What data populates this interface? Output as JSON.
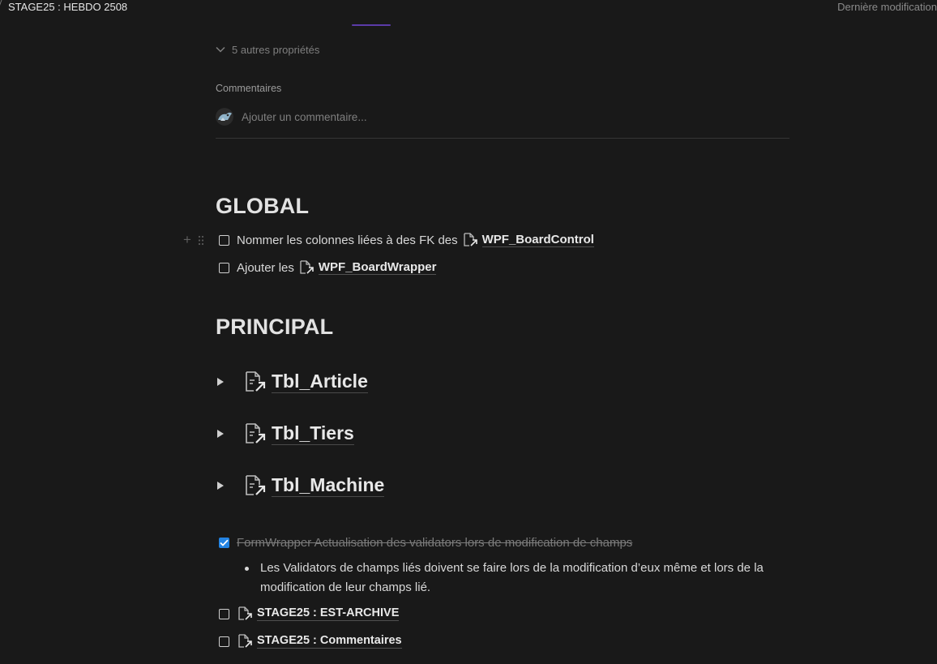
{
  "header": {
    "breadcrumb_title": "STAGE25 : HEBDO 2508",
    "last_modified": "Dernière modification"
  },
  "properties": {
    "more_label": "5 autres propriétés"
  },
  "comments": {
    "label": "Commentaires",
    "placeholder": "Ajouter un commentaire..."
  },
  "global": {
    "heading": "GLOBAL",
    "todos": [
      {
        "prefix": "Nommer les colonnes liées à des FK des",
        "link": "WPF_BoardControl",
        "checked": false
      },
      {
        "prefix": "Ajouter les",
        "link": "WPF_BoardWrapper",
        "checked": false
      }
    ]
  },
  "principal": {
    "heading": "PRINCIPAL",
    "toggles": [
      {
        "label": "Tbl_Article"
      },
      {
        "label": "Tbl_Tiers"
      },
      {
        "label": "Tbl_Machine"
      }
    ]
  },
  "tasks": {
    "done_item": "FormWrapper Actualisation des validators lors de modification de champs",
    "bullet": "Les Validators de champs liés doivent se faire lors de la modification d’eux même et lors de la modification de leur champs lié.",
    "items": [
      {
        "link": "STAGE25 : EST-ARCHIVE",
        "checked": false
      },
      {
        "link": "STAGE25 : Commentaires",
        "checked": false
      }
    ]
  },
  "colors": {
    "background": "#191919",
    "text": "#d4d4d4",
    "muted": "#7f7f7f",
    "checkbox_checked": "#2383e2",
    "accent_purple": "#5b3ba8"
  }
}
